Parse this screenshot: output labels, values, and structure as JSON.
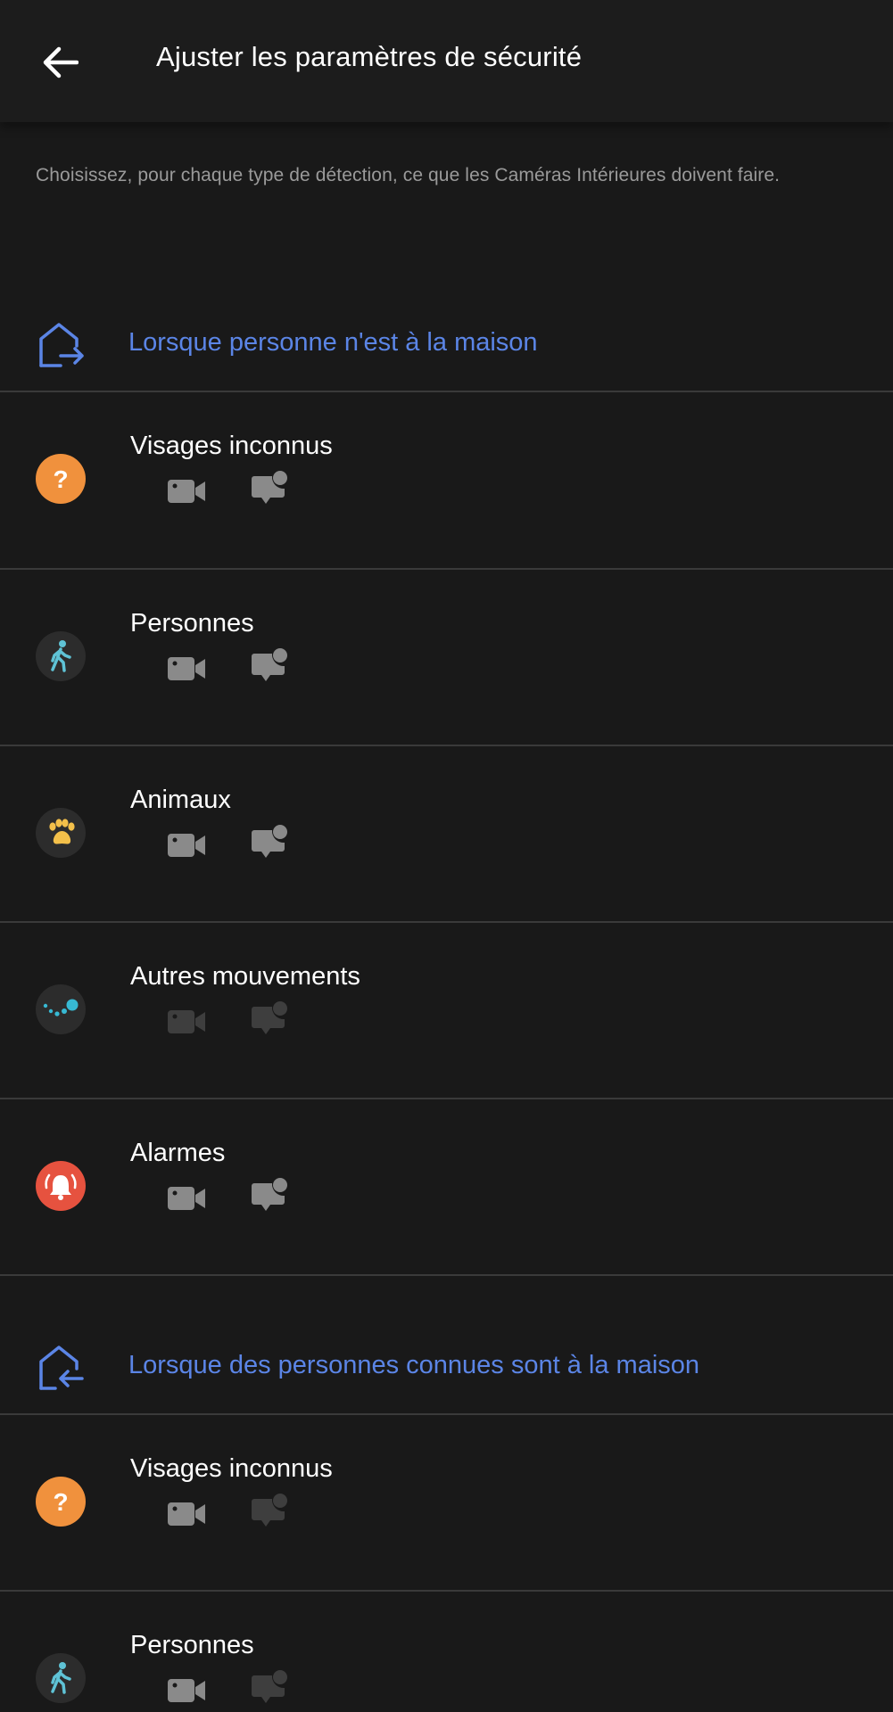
{
  "header": {
    "title": "Ajuster les paramètres de sécurité"
  },
  "intro": "Choisissez, pour chaque type de détection, ce que les Caméras Intérieures doivent faire.",
  "colors": {
    "accent": "#5b85e6",
    "unknown_face": "#f0913d",
    "person": "#5fc3d6",
    "animal": "#f3c04a",
    "motion": "#37b9d3",
    "alarm": "#e6523f",
    "action_on": "#8a8a8a",
    "action_off": "#3e3e3e"
  },
  "sections": [
    {
      "label": "Lorsque personne n'est à la maison",
      "icon": "house-leave-icon",
      "items": [
        {
          "label": "Visages inconnus",
          "icon": "question-icon",
          "record": "on",
          "notify": "on"
        },
        {
          "label": "Personnes",
          "icon": "walking-person-icon",
          "record": "on",
          "notify": "on"
        },
        {
          "label": "Animaux",
          "icon": "paw-icon",
          "record": "on",
          "notify": "on"
        },
        {
          "label": "Autres mouvements",
          "icon": "motion-dots-icon",
          "record": "off",
          "notify": "off"
        },
        {
          "label": "Alarmes",
          "icon": "alarm-bell-icon",
          "record": "on",
          "notify": "on"
        }
      ]
    },
    {
      "label": "Lorsque des personnes connues sont à la maison",
      "icon": "house-enter-icon",
      "items": [
        {
          "label": "Visages inconnus",
          "icon": "question-icon",
          "record": "on",
          "notify": "off"
        },
        {
          "label": "Personnes",
          "icon": "walking-person-icon",
          "record": "on",
          "notify": "off"
        }
      ]
    }
  ]
}
